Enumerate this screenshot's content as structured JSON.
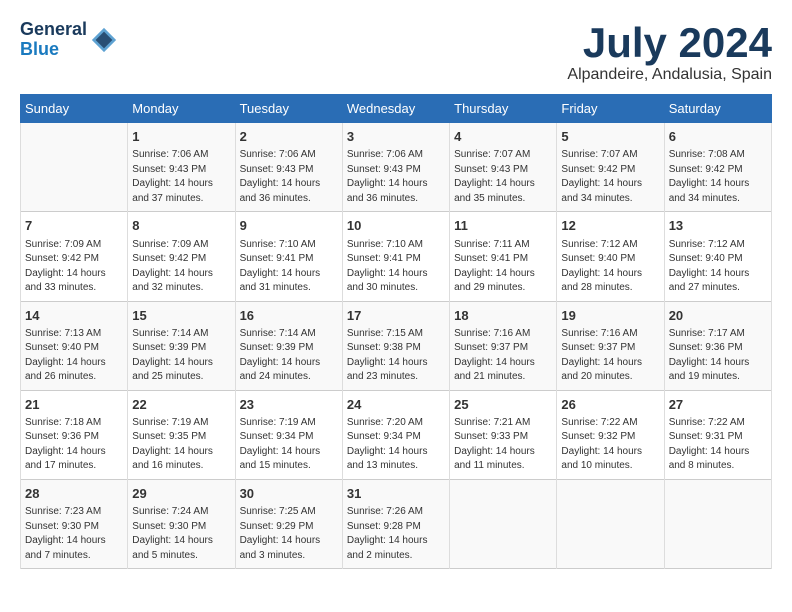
{
  "header": {
    "logo_line1": "General",
    "logo_line2": "Blue",
    "month": "July 2024",
    "location": "Alpandeire, Andalusia, Spain"
  },
  "days_of_week": [
    "Sunday",
    "Monday",
    "Tuesday",
    "Wednesday",
    "Thursday",
    "Friday",
    "Saturday"
  ],
  "weeks": [
    [
      {
        "day": "",
        "data": ""
      },
      {
        "day": "1",
        "data": "Sunrise: 7:06 AM\nSunset: 9:43 PM\nDaylight: 14 hours\nand 37 minutes."
      },
      {
        "day": "2",
        "data": "Sunrise: 7:06 AM\nSunset: 9:43 PM\nDaylight: 14 hours\nand 36 minutes."
      },
      {
        "day": "3",
        "data": "Sunrise: 7:06 AM\nSunset: 9:43 PM\nDaylight: 14 hours\nand 36 minutes."
      },
      {
        "day": "4",
        "data": "Sunrise: 7:07 AM\nSunset: 9:43 PM\nDaylight: 14 hours\nand 35 minutes."
      },
      {
        "day": "5",
        "data": "Sunrise: 7:07 AM\nSunset: 9:42 PM\nDaylight: 14 hours\nand 34 minutes."
      },
      {
        "day": "6",
        "data": "Sunrise: 7:08 AM\nSunset: 9:42 PM\nDaylight: 14 hours\nand 34 minutes."
      }
    ],
    [
      {
        "day": "7",
        "data": "Sunrise: 7:09 AM\nSunset: 9:42 PM\nDaylight: 14 hours\nand 33 minutes."
      },
      {
        "day": "8",
        "data": "Sunrise: 7:09 AM\nSunset: 9:42 PM\nDaylight: 14 hours\nand 32 minutes."
      },
      {
        "day": "9",
        "data": "Sunrise: 7:10 AM\nSunset: 9:41 PM\nDaylight: 14 hours\nand 31 minutes."
      },
      {
        "day": "10",
        "data": "Sunrise: 7:10 AM\nSunset: 9:41 PM\nDaylight: 14 hours\nand 30 minutes."
      },
      {
        "day": "11",
        "data": "Sunrise: 7:11 AM\nSunset: 9:41 PM\nDaylight: 14 hours\nand 29 minutes."
      },
      {
        "day": "12",
        "data": "Sunrise: 7:12 AM\nSunset: 9:40 PM\nDaylight: 14 hours\nand 28 minutes."
      },
      {
        "day": "13",
        "data": "Sunrise: 7:12 AM\nSunset: 9:40 PM\nDaylight: 14 hours\nand 27 minutes."
      }
    ],
    [
      {
        "day": "14",
        "data": "Sunrise: 7:13 AM\nSunset: 9:40 PM\nDaylight: 14 hours\nand 26 minutes."
      },
      {
        "day": "15",
        "data": "Sunrise: 7:14 AM\nSunset: 9:39 PM\nDaylight: 14 hours\nand 25 minutes."
      },
      {
        "day": "16",
        "data": "Sunrise: 7:14 AM\nSunset: 9:39 PM\nDaylight: 14 hours\nand 24 minutes."
      },
      {
        "day": "17",
        "data": "Sunrise: 7:15 AM\nSunset: 9:38 PM\nDaylight: 14 hours\nand 23 minutes."
      },
      {
        "day": "18",
        "data": "Sunrise: 7:16 AM\nSunset: 9:37 PM\nDaylight: 14 hours\nand 21 minutes."
      },
      {
        "day": "19",
        "data": "Sunrise: 7:16 AM\nSunset: 9:37 PM\nDaylight: 14 hours\nand 20 minutes."
      },
      {
        "day": "20",
        "data": "Sunrise: 7:17 AM\nSunset: 9:36 PM\nDaylight: 14 hours\nand 19 minutes."
      }
    ],
    [
      {
        "day": "21",
        "data": "Sunrise: 7:18 AM\nSunset: 9:36 PM\nDaylight: 14 hours\nand 17 minutes."
      },
      {
        "day": "22",
        "data": "Sunrise: 7:19 AM\nSunset: 9:35 PM\nDaylight: 14 hours\nand 16 minutes."
      },
      {
        "day": "23",
        "data": "Sunrise: 7:19 AM\nSunset: 9:34 PM\nDaylight: 14 hours\nand 15 minutes."
      },
      {
        "day": "24",
        "data": "Sunrise: 7:20 AM\nSunset: 9:34 PM\nDaylight: 14 hours\nand 13 minutes."
      },
      {
        "day": "25",
        "data": "Sunrise: 7:21 AM\nSunset: 9:33 PM\nDaylight: 14 hours\nand 11 minutes."
      },
      {
        "day": "26",
        "data": "Sunrise: 7:22 AM\nSunset: 9:32 PM\nDaylight: 14 hours\nand 10 minutes."
      },
      {
        "day": "27",
        "data": "Sunrise: 7:22 AM\nSunset: 9:31 PM\nDaylight: 14 hours\nand 8 minutes."
      }
    ],
    [
      {
        "day": "28",
        "data": "Sunrise: 7:23 AM\nSunset: 9:30 PM\nDaylight: 14 hours\nand 7 minutes."
      },
      {
        "day": "29",
        "data": "Sunrise: 7:24 AM\nSunset: 9:30 PM\nDaylight: 14 hours\nand 5 minutes."
      },
      {
        "day": "30",
        "data": "Sunrise: 7:25 AM\nSunset: 9:29 PM\nDaylight: 14 hours\nand 3 minutes."
      },
      {
        "day": "31",
        "data": "Sunrise: 7:26 AM\nSunset: 9:28 PM\nDaylight: 14 hours\nand 2 minutes."
      },
      {
        "day": "",
        "data": ""
      },
      {
        "day": "",
        "data": ""
      },
      {
        "day": "",
        "data": ""
      }
    ]
  ]
}
